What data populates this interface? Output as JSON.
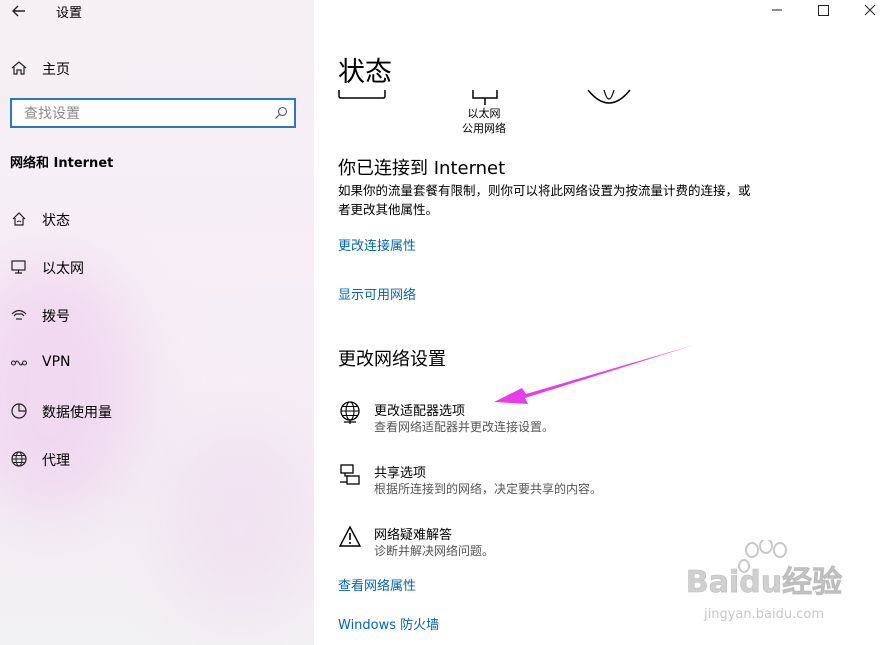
{
  "app": {
    "title": "设置"
  },
  "sidebar": {
    "home_label": "主页",
    "search_placeholder": "查找设置",
    "section_title": "网络和 Internet",
    "items": [
      {
        "label": "状态",
        "icon": "home-wifi-icon"
      },
      {
        "label": "以太网",
        "icon": "ethernet-icon"
      },
      {
        "label": "拨号",
        "icon": "dialup-icon"
      },
      {
        "label": "VPN",
        "icon": "vpn-icon"
      },
      {
        "label": "数据使用量",
        "icon": "data-usage-icon"
      },
      {
        "label": "代理",
        "icon": "globe-icon"
      }
    ]
  },
  "main": {
    "title": "状态",
    "diagram": {
      "ethernet_label": "以太网",
      "network_profile": "公用网络"
    },
    "connected_title": "你已连接到 Internet",
    "connected_desc": "如果你的流量套餐有限制，则你可以将此网络设置为按流量计费的连接，或者更改其他属性。",
    "links": {
      "change_connection_props": "更改连接属性",
      "show_available_networks": "显示可用网络",
      "view_network_props": "查看网络属性",
      "windows_firewall": "Windows 防火墙"
    },
    "change_settings_title": "更改网络设置",
    "options": [
      {
        "title": "更改适配器选项",
        "desc": "查看网络适配器并更改连接设置。",
        "icon": "adapter-globe-icon"
      },
      {
        "title": "共享选项",
        "desc": "根据所连接到的网络，决定要共享的内容。",
        "icon": "sharing-icon"
      },
      {
        "title": "网络疑难解答",
        "desc": "诊断并解决网络问题。",
        "icon": "warning-icon"
      }
    ]
  },
  "annotation": {
    "arrow_color": "#e83ce8"
  },
  "watermark": {
    "brand": "Baidu经验",
    "url": "jingyan.baidu.com"
  },
  "colors": {
    "link": "#0067b8",
    "search_border": "#2b78c2"
  }
}
